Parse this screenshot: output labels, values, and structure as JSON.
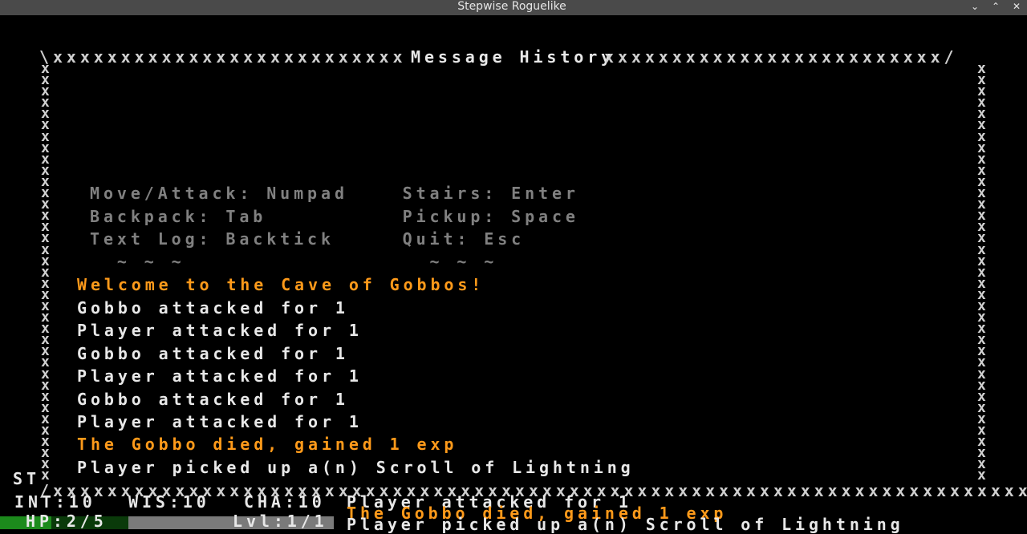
{
  "window": {
    "title": "Stepwise Roguelike",
    "buttons": [
      "⌄",
      "⌃",
      "✕"
    ]
  },
  "history": {
    "title": "Message History",
    "top_left": "\\xxxxxxxxxxxxxxxxxxxxxxxxxx",
    "top_right": "xxxxxxxxxxxxxxxxxxxxxxxxx/",
    "bottom": "/xxxxxxxxxxxxxxxxxxxxxxxxxxxxxxxxxxxxxxxxxxxxxxxxxxxxxxxxxxxxxxxxxxxxxxxx\\",
    "side": "x\nx\nx\nx\nx\nx\nx\nx\nx\nx\nx\nx\nx\nx\nx\nx\nx\nx\nx\nx\nx\nx\nx\nx\nx\nx\nx\nx\nx\nx\nx\nx\nx\nx\nx\nx\nx",
    "help": [
      "Move/Attack: Numpad    Stairs: Enter",
      "Backpack: Tab          Pickup: Space",
      "Text Log: Backtick     Quit: Esc",
      "  ~ ~ ~                  ~ ~ ~"
    ],
    "messages": [
      {
        "text": "Welcome to the Cave of Gobbos!",
        "color": "orange"
      },
      {
        "text": "Gobbo attacked for 1",
        "color": "white"
      },
      {
        "text": "Player attacked for 1",
        "color": "white"
      },
      {
        "text": "Gobbo attacked for 1",
        "color": "white"
      },
      {
        "text": "Player attacked for 1",
        "color": "white"
      },
      {
        "text": "Gobbo attacked for 1",
        "color": "white"
      },
      {
        "text": "Player attacked for 1",
        "color": "white"
      },
      {
        "text": "The Gobbo died, gained 1 exp",
        "color": "orange"
      },
      {
        "text": "Player picked up a(n) Scroll of Lightning",
        "color": "white"
      }
    ]
  },
  "status": {
    "st": "ST",
    "int": "INT:10",
    "wis": "WIS:10",
    "cha": "CHA:10",
    "hp": "HP:2/5",
    "hp_fraction": 0.4,
    "lvl": "Lvl:1/1",
    "log": [
      {
        "text": "Player attacked for 1",
        "color": "white"
      },
      {
        "text": "The Gobbo died, gained 1 exp",
        "color": "orange"
      },
      {
        "text": "Player picked up a(n) Scroll of Lightning",
        "color": "white"
      }
    ]
  },
  "colors": {
    "hp_green": "#1c8a1c",
    "hp_empty": "#0a3a0a",
    "xp_gray": "#7a7a7a",
    "orange": "#ff9a1a",
    "white": "#e8e8e8",
    "gray": "#808080"
  }
}
